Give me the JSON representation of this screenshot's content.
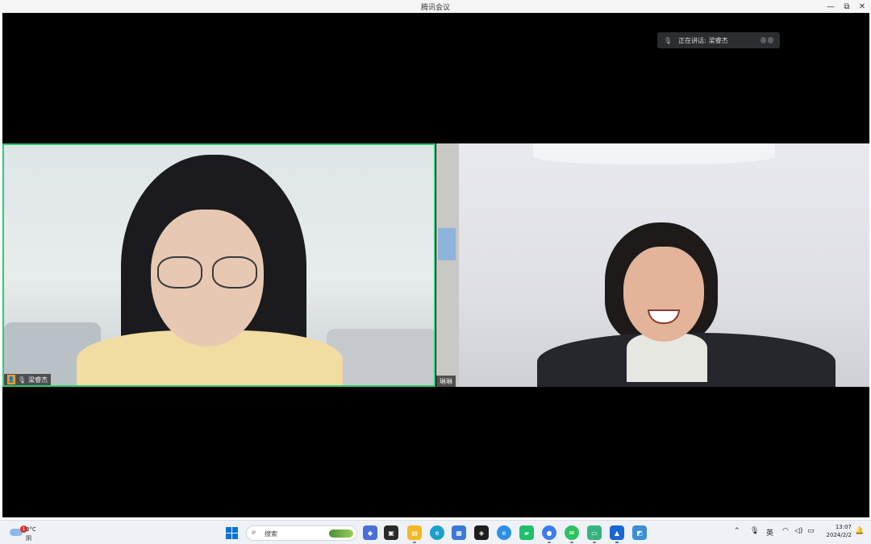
{
  "window": {
    "title": "腾讯会议",
    "minimize_icon": "—",
    "maximize_icon": "⧉",
    "close_icon": "✕"
  },
  "speaking_indicator": {
    "label": "正在讲话:",
    "name": "梁睿杰"
  },
  "participants": [
    {
      "name": "梁睿杰",
      "host": true,
      "active_speaker": true
    },
    {
      "name": "琳琳",
      "host": false,
      "active_speaker": false
    }
  ],
  "taskbar": {
    "weather": {
      "temperature": "3°C",
      "condition": "阴",
      "alert_count": "1"
    },
    "search_placeholder": "搜索",
    "language": "英",
    "time": "13:07",
    "date": "2024/2/2"
  },
  "colors": {
    "active_border": "#2ecc71",
    "stage_background": "#000000",
    "taskbar_background": "#eef1f5",
    "accent": "#0a74d6"
  }
}
